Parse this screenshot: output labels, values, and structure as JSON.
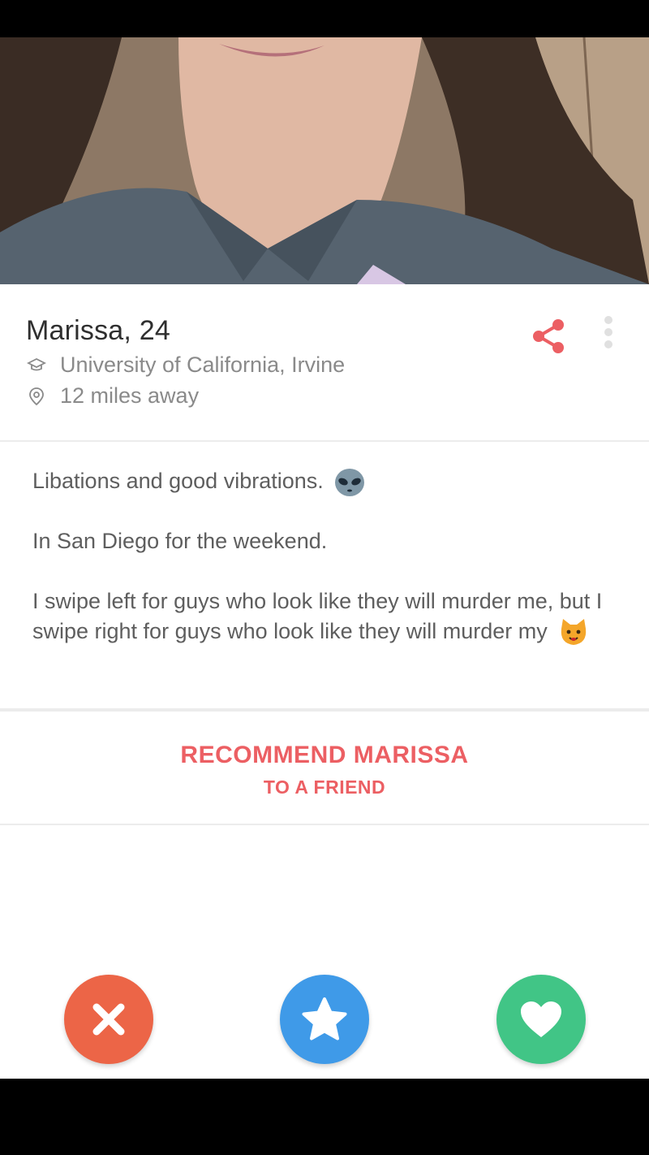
{
  "profile": {
    "name_age": "Marissa, 24",
    "school": "University of California, Irvine",
    "distance": "12 miles away"
  },
  "bio": {
    "line1": "Libations and good vibrations.",
    "line1_emoji": "alien-emoji",
    "line2": "In San Diego for the weekend.",
    "line3": "I swipe left for guys who look like they will murder me, but I swipe right for guys who look like they will murder my",
    "line3_emoji": "cat-emoji"
  },
  "recommend": {
    "line1": "RECOMMEND MARISSA",
    "line2": "TO A FRIEND"
  },
  "icons": {
    "school": "graduation-cap-icon",
    "distance": "location-pin-icon",
    "share": "share-icon",
    "more": "more-vertical-icon",
    "nope": "close-icon",
    "super_like": "star-icon",
    "like": "heart-icon"
  },
  "colors": {
    "accent": "#ec5f63",
    "nope": "#ec6547",
    "super_like": "#3f9ae8",
    "like": "#41c586",
    "text_primary": "#2f2f2f",
    "text_secondary": "#8a8a8a"
  }
}
